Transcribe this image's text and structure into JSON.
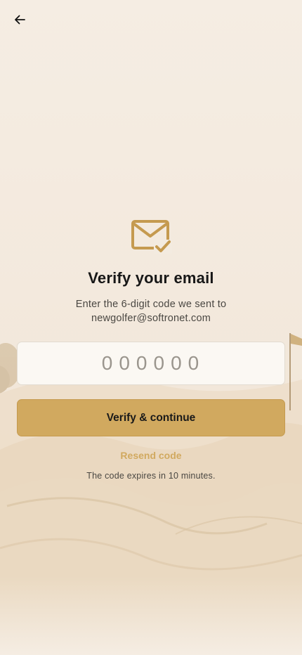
{
  "header": {
    "back_icon": "arrow-left-icon"
  },
  "hero": {
    "icon": "mail-check-icon"
  },
  "title": "Verify your email",
  "subtitle_line1": "Enter the 6-digit code we sent to",
  "subtitle_email": "newgolfer@softronet.com",
  "code_input": {
    "placeholder": "000000",
    "value": ""
  },
  "verify_button": "Verify & continue",
  "resend_link": "Resend code",
  "expires_note": "The code expires in 10 minutes.",
  "colors": {
    "accent": "#d1a95f",
    "background": "#f5ede3",
    "text_primary": "#171717",
    "text_secondary": "#4a4742"
  }
}
